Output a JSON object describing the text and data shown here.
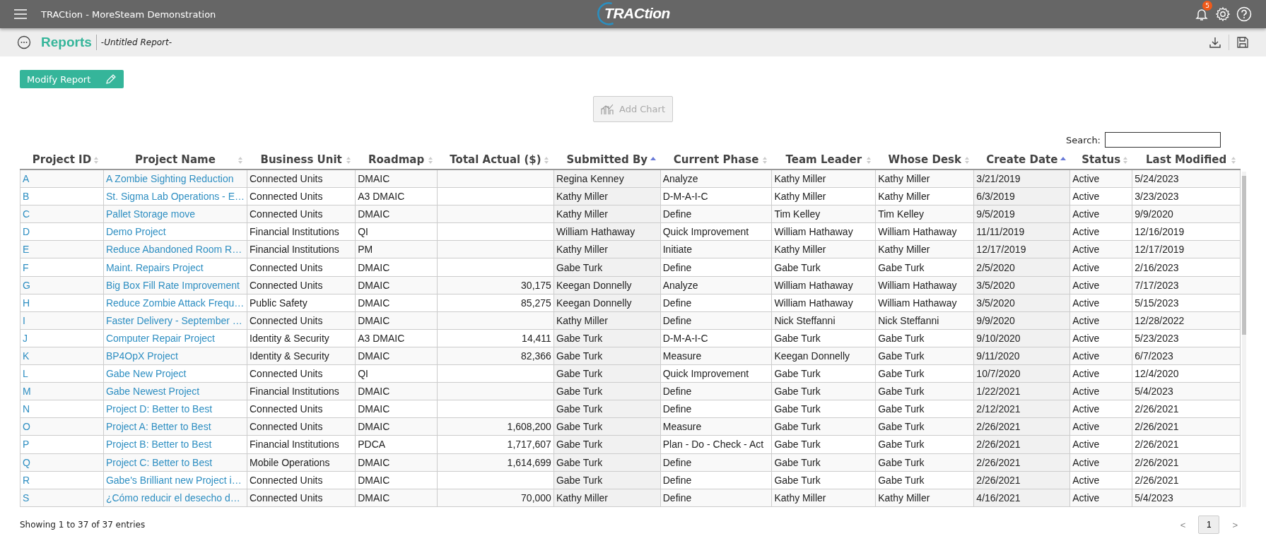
{
  "app_bar": {
    "title": "TRACtion - MoreSteam Demonstration",
    "logo_text": "TRACtion",
    "notification_count": "5"
  },
  "page_header": {
    "title": "Reports",
    "subtitle": "-Untitled Report-"
  },
  "modify_button": "Modify Report",
  "add_chart_button": {
    "label": "Add Chart",
    "disabled": true
  },
  "search": {
    "label": "Search:"
  },
  "table": {
    "columns": [
      {
        "label": "Project ID",
        "kind": "link",
        "sorted": false
      },
      {
        "label": "Project Name",
        "kind": "link",
        "sorted": false
      },
      {
        "label": "Business Unit",
        "kind": "text",
        "sorted": false
      },
      {
        "label": "Roadmap",
        "kind": "text",
        "sorted": false
      },
      {
        "label": "Total Actual ($)",
        "kind": "number",
        "sorted": false
      },
      {
        "label": "Submitted By",
        "kind": "text",
        "sorted": true
      },
      {
        "label": "Current Phase",
        "kind": "text",
        "sorted": false
      },
      {
        "label": "Team Leader",
        "kind": "text",
        "sorted": false
      },
      {
        "label": "Whose Desk",
        "kind": "text",
        "sorted": false
      },
      {
        "label": "Create Date",
        "kind": "text",
        "sorted": true
      },
      {
        "label": "Status",
        "kind": "text",
        "sorted": false
      },
      {
        "label": "Last Modified",
        "kind": "text",
        "sorted": false
      }
    ],
    "rows": [
      [
        "A",
        "A Zombie Sighting Reduction",
        "Connected Units",
        "DMAIC",
        "",
        "Regina Kenney",
        "Analyze",
        "Kathy Miller",
        "Kathy Miller",
        "3/21/2019",
        "Active",
        "5/24/2023"
      ],
      [
        "B",
        "St. Sigma Lab Operations - E…",
        "Connected Units",
        "A3 DMAIC",
        "",
        "Kathy Miller",
        "D-M-A-I-C",
        "Kathy Miller",
        "Kathy Miller",
        "6/3/2019",
        "Active",
        "3/23/2023"
      ],
      [
        "C",
        "Pallet Storage move",
        "Connected Units",
        "DMAIC",
        "",
        "Kathy Miller",
        "Define",
        "Tim Kelley",
        "Tim Kelley",
        "9/5/2019",
        "Active",
        "9/9/2020"
      ],
      [
        "D",
        "Demo Project",
        "Financial Institutions",
        "QI",
        "",
        "William Hathaway",
        "Quick Improvement",
        "William Hathaway",
        "William Hathaway",
        "11/11/2019",
        "Active",
        "12/16/2019"
      ],
      [
        "E",
        "Reduce Abandoned Room R…",
        "Financial Institutions",
        "PM",
        "",
        "Kathy Miller",
        "Initiate",
        "Kathy Miller",
        "Kathy Miller",
        "12/17/2019",
        "Active",
        "12/17/2019"
      ],
      [
        "F",
        "Maint. Repairs Project",
        "Connected Units",
        "DMAIC",
        "",
        "Gabe Turk",
        "Define",
        "Gabe Turk",
        "Gabe Turk",
        "2/5/2020",
        "Active",
        "2/16/2023"
      ],
      [
        "G",
        "Big Box Fill Rate Improvement",
        "Connected Units",
        "DMAIC",
        "30,175",
        "Keegan Donnelly",
        "Analyze",
        "William Hathaway",
        "William Hathaway",
        "3/5/2020",
        "Active",
        "7/17/2023"
      ],
      [
        "H",
        "Reduce Zombie Attack Frequ…",
        "Public Safety",
        "DMAIC",
        "85,275",
        "Keegan Donnelly",
        "Define",
        "William Hathaway",
        "William Hathaway",
        "3/5/2020",
        "Active",
        "5/15/2023"
      ],
      [
        "I",
        "Faster Delivery - September …",
        "Connected Units",
        "DMAIC",
        "",
        "Kathy Miller",
        "Define",
        "Nick Steffanni",
        "Nick Steffanni",
        "9/9/2020",
        "Active",
        "12/28/2022"
      ],
      [
        "J",
        "Computer Repair Project",
        "Identity & Security",
        "A3 DMAIC",
        "14,411",
        "Gabe Turk",
        "D-M-A-I-C",
        "Gabe Turk",
        "Gabe Turk",
        "9/10/2020",
        "Active",
        "5/23/2023"
      ],
      [
        "K",
        "BP4OpX Project",
        "Identity & Security",
        "DMAIC",
        "82,366",
        "Gabe Turk",
        "Measure",
        "Keegan Donnelly",
        "Gabe Turk",
        "9/11/2020",
        "Active",
        "6/7/2023"
      ],
      [
        "L",
        "Gabe New Project",
        "Connected Units",
        "QI",
        "",
        "Gabe Turk",
        "Quick Improvement",
        "Gabe Turk",
        "Gabe Turk",
        "10/7/2020",
        "Active",
        "12/4/2020"
      ],
      [
        "M",
        "Gabe Newest Project",
        "Financial Institutions",
        "DMAIC",
        "",
        "Gabe Turk",
        "Define",
        "Gabe Turk",
        "Gabe Turk",
        "1/22/2021",
        "Active",
        "5/4/2023"
      ],
      [
        "N",
        "Project D: Better to Best",
        "Connected Units",
        "DMAIC",
        "",
        "Gabe Turk",
        "Define",
        "Gabe Turk",
        "Gabe Turk",
        "2/12/2021",
        "Active",
        "2/26/2021"
      ],
      [
        "O",
        "Project A: Better to Best",
        "Connected Units",
        "DMAIC",
        "1,608,200",
        "Gabe Turk",
        "Measure",
        "Gabe Turk",
        "Gabe Turk",
        "2/26/2021",
        "Active",
        "2/26/2021"
      ],
      [
        "P",
        "Project B: Better to Best",
        "Financial Institutions",
        "PDCA",
        "1,717,607",
        "Gabe Turk",
        "Plan - Do - Check - Act",
        "Gabe Turk",
        "Gabe Turk",
        "2/26/2021",
        "Active",
        "2/26/2021"
      ],
      [
        "Q",
        "Project C: Better to Best",
        "Mobile Operations",
        "DMAIC",
        "1,614,699",
        "Gabe Turk",
        "Define",
        "Gabe Turk",
        "Gabe Turk",
        "2/26/2021",
        "Active",
        "2/26/2021"
      ],
      [
        "R",
        "Gabe's Brilliant new Project i…",
        "Connected Units",
        "DMAIC",
        "",
        "Gabe Turk",
        "Define",
        "Gabe Turk",
        "Gabe Turk",
        "2/26/2021",
        "Active",
        "2/26/2021"
      ],
      [
        "S",
        "¿Cómo reducir el desecho d…",
        "Connected Units",
        "DMAIC",
        "70,000",
        "Kathy Miller",
        "Define",
        "Kathy Miller",
        "Kathy Miller",
        "4/16/2021",
        "Active",
        "5/4/2023"
      ]
    ]
  },
  "footer": {
    "info": "Showing 1 to 37 of 37 entries",
    "prev": "<",
    "next": ">",
    "pages": [
      {
        "label": "1",
        "selected": true
      }
    ]
  }
}
